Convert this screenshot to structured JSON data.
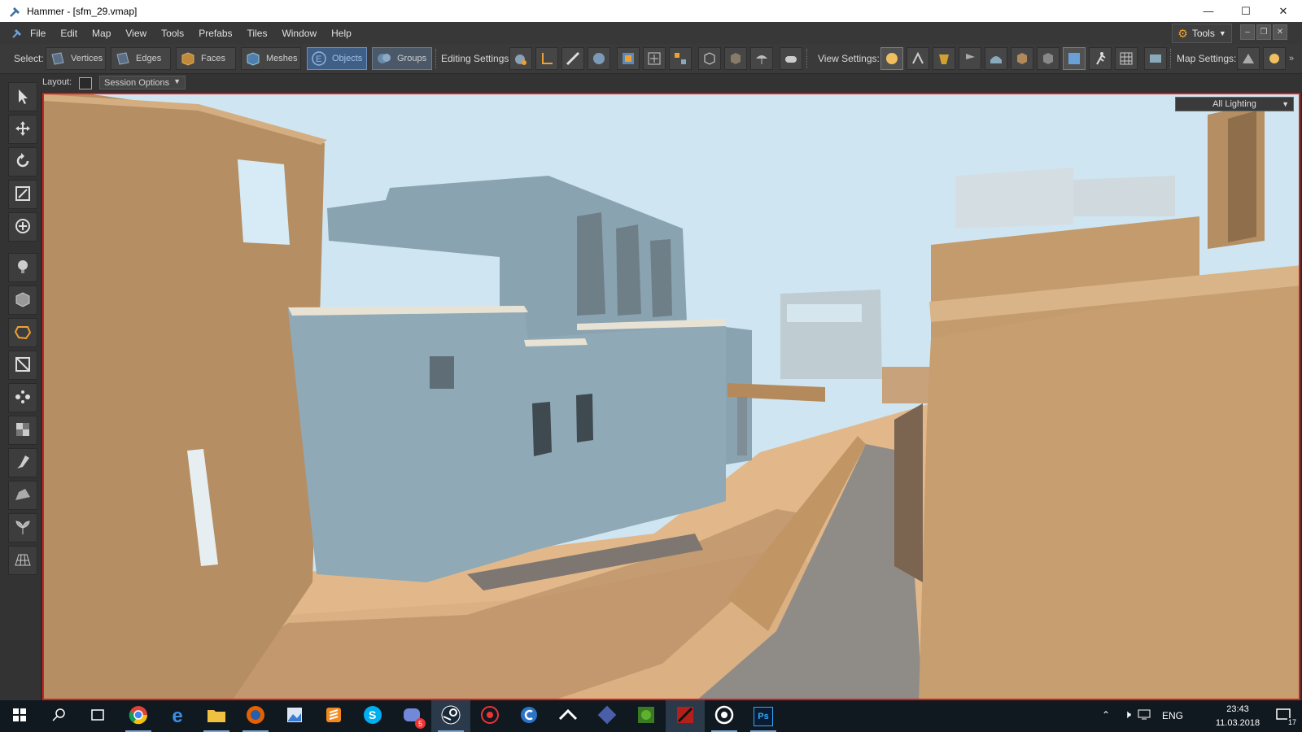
{
  "window": {
    "title": "Hammer - [sfm_29.vmap]"
  },
  "menu": {
    "items": [
      "File",
      "Edit",
      "Map",
      "View",
      "Tools",
      "Prefabs",
      "Tiles",
      "Window",
      "Help"
    ],
    "tools_button": "Tools"
  },
  "toolbar": {
    "select_label": "Select:",
    "select_modes": [
      "Vertices",
      "Edges",
      "Faces",
      "Meshes",
      "Objects",
      "Groups"
    ],
    "active_mode": "Objects",
    "editing_label": "Editing Settings:",
    "view_label": "View Settings:",
    "map_label": "Map Settings:"
  },
  "layout_bar": {
    "label": "Layout:",
    "session_options": "Session Options"
  },
  "viewport": {
    "lighting_mode": "All Lighting",
    "border_color": "#d62020"
  },
  "taskbar": {
    "language": "ENG",
    "time": "23:43",
    "date": "11.03.2018",
    "notification_count": "17",
    "discord_badge": "5",
    "photoshop_label": "Ps"
  },
  "icons": [
    "hammer-icon",
    "gear-icon",
    "select-arrow-icon",
    "move-icon",
    "rotate-icon",
    "scale-icon",
    "pivot-icon",
    "light-icon",
    "block-icon",
    "polygon-icon",
    "clip-icon",
    "vertex-icon",
    "texture-icon",
    "paint-icon",
    "terrain-icon",
    "foliage-icon",
    "tile-icon"
  ]
}
